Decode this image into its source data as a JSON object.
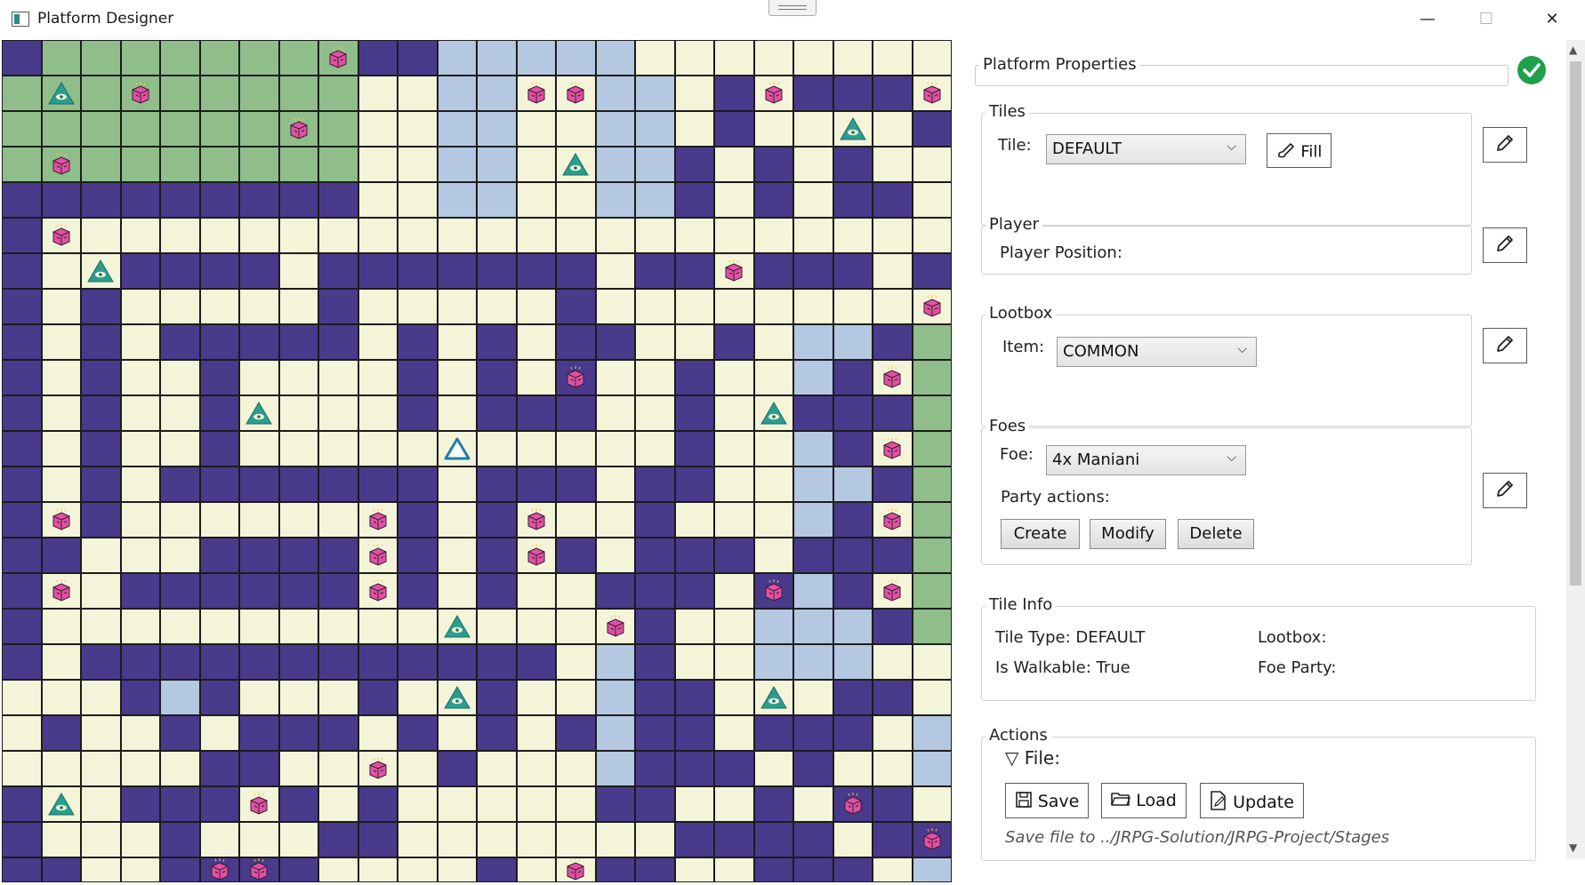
{
  "window": {
    "title": "Platform Designer",
    "minimize": "—",
    "maximize": "☐",
    "close": "✕"
  },
  "colors": {
    "dark": "#4a3a8c",
    "floor": "#f4f4d8",
    "grass": "#8fbe8b",
    "water": "#b4c8e2",
    "accent": "#2a9d8f",
    "lootbox": "#e052a0",
    "ok": "#1fa04a"
  },
  "map": {
    "rows": [
      "DGGGGGGGGDDWWWWWFFFFFFFF",
      "GGGGGGGGGFFWWFFWWFDFDDDF",
      "GGGGGGGGGFFWWFFWWFDFFFFD",
      "GGGGGGGGGFFWWFFWWDFDFDFF",
      "DDDDDDDDDFFWWFFWWDFDFDDF",
      "DFFFFFFFFFFFFFFFFFFFFFFF",
      "DFFDDDDFDDDDDDDFDDFDDDFD",
      "DFDFFFFFDFFFFFDFFFFFFFFF",
      "DFDFDDDDDFDFDFDDFFDFWWDG",
      "DFDFFDFFFFDFDFDFFDFFWDFG",
      "DFDFFDFFFFDFDDDFFDFFDDDG",
      "DFDFFDFFFFFFFFFFFDFFWDFG",
      "DFDFDDDDDDDFDDDFDDFFWWDG",
      "DFDFFFFFFFDFDFFFDFFFWDFG",
      "DDFFFDDDDFDFDFDFDDDFDDDG",
      "DFFDDDDDDFDFDFFDDDFDWDFG",
      "DFFFFFFFFFFFFFFFDFFWWWDG",
      "DFDDDDDDDDDDDDFWDFFWWWFF",
      "FFFDWDFFFDFFDFFWDDFFFDDF",
      "FDFFDFDDDFDFDFDWDDFDDDFW",
      "FFFFFDDFFFFDFFFWDDDFDFFW",
      "DFFDDDFDFDFFFFFDDFFDFDDF",
      "DFFFDFFFDDFFFFFFFDDDDFDD",
      "DDFFDDDDFFFFDFFDDFFDDDFW"
    ],
    "triangles": [
      [
        1,
        1
      ],
      [
        2,
        21
      ],
      [
        3,
        14
      ],
      [
        6,
        2
      ],
      [
        10,
        6
      ],
      [
        10,
        19
      ],
      [
        16,
        11
      ],
      [
        18,
        11
      ],
      [
        18,
        19
      ],
      [
        21,
        1
      ]
    ],
    "spawn": [
      [
        11,
        11
      ]
    ],
    "lootboxes": [
      [
        0,
        8
      ],
      [
        1,
        3
      ],
      [
        1,
        13
      ],
      [
        1,
        14
      ],
      [
        1,
        19
      ],
      [
        1,
        23
      ],
      [
        2,
        7
      ],
      [
        3,
        1
      ],
      [
        5,
        1
      ],
      [
        6,
        18
      ],
      [
        7,
        23
      ],
      [
        9,
        14
      ],
      [
        9,
        22
      ],
      [
        11,
        22
      ],
      [
        13,
        1
      ],
      [
        13,
        9
      ],
      [
        13,
        13
      ],
      [
        13,
        22
      ],
      [
        14,
        9
      ],
      [
        14,
        13
      ],
      [
        15,
        1
      ],
      [
        15,
        9
      ],
      [
        15,
        19
      ],
      [
        15,
        22
      ],
      [
        16,
        15
      ],
      [
        20,
        9
      ],
      [
        21,
        6
      ],
      [
        21,
        21
      ],
      [
        22,
        23
      ],
      [
        23,
        5
      ],
      [
        23,
        6
      ],
      [
        23,
        14
      ]
    ]
  },
  "panel": {
    "platform_properties": "Platform Properties",
    "tiles": {
      "legend": "Tiles",
      "tile_label": "Tile:",
      "tile_value": "DEFAULT",
      "fill_button": "Fill"
    },
    "player": {
      "legend": "Player",
      "position_label": "Player Position:"
    },
    "lootbox": {
      "legend": "Lootbox",
      "item_label": "Item:",
      "item_value": "COMMON"
    },
    "foes": {
      "legend": "Foes",
      "foe_label": "Foe:",
      "foe_value": "4x Maniani",
      "party_actions": "Party actions:",
      "create": "Create",
      "modify": "Modify",
      "delete": "Delete"
    },
    "tile_info": {
      "legend": "Tile Info",
      "tile_type": "Tile Type: DEFAULT",
      "lootbox": "Lootbox:",
      "walkable": "Is Walkable: True",
      "foe_party": "Foe Party:"
    },
    "actions": {
      "legend": "Actions",
      "file_label": "File:",
      "save": "Save",
      "load": "Load",
      "update": "Update",
      "save_path": "Save file to ../JRPG-Solution/JRPG-Project/Stages"
    }
  }
}
